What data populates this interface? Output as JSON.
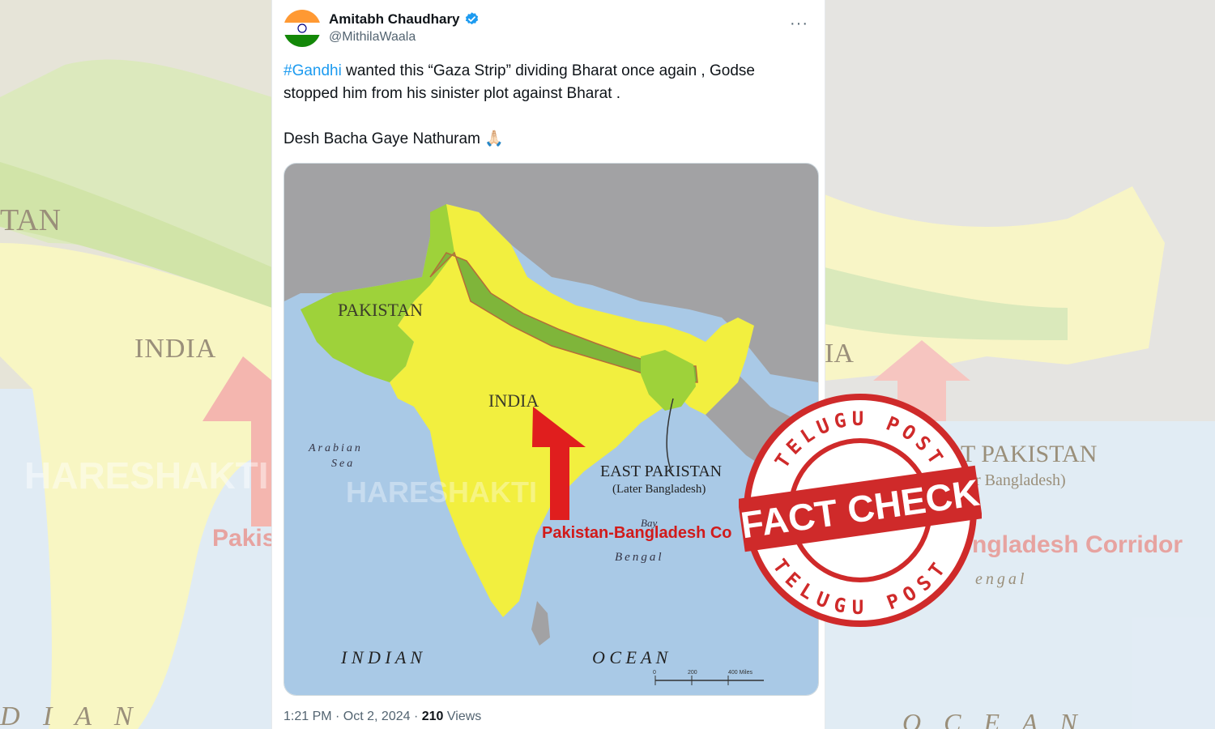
{
  "background": {
    "left_labels": {
      "india": "INDIA",
      "pakistan_partial": "TAN",
      "corridor_partial": "Pakis",
      "watermark": "HARESHAKTI",
      "ocean_partial": "D I A N"
    },
    "right_labels": {
      "east_pakistan_partial": "T PAKISTAN",
      "later_bangladesh_partial": "r Bangladesh)",
      "corridor_partial": "ngladesh Corridor",
      "india_partial": "IA",
      "bengal_partial": "engal",
      "ocean_partial": "O C E A N"
    }
  },
  "tweet": {
    "author_name": "Amitabh Chaudhary",
    "author_handle": "@MithilaWaala",
    "verified_icon": "verified-badge-icon",
    "more_icon": "more-options-icon",
    "more_label": "···",
    "hashtag": "#Gandhi",
    "text_line1_rest": " wanted this “Gaza Strip” dividing Bharat once again , Godse stopped him from his sinister plot against Bharat .",
    "text_line2": "Desh Bacha Gaye Nathuram 🙏🏻",
    "time": "1:21 PM · Oct 2, 2024 · ",
    "views_count": "210",
    "views_label": " Views"
  },
  "map": {
    "pakistan": "PAKISTAN",
    "india": "INDIA",
    "arabian_sea_1": "Arabian",
    "arabian_sea_2": "Sea",
    "east_pakistan": "EAST PAKISTAN",
    "later_bangladesh": "(Later Bangladesh)",
    "corridor": "Pakistan-Bangladesh Co",
    "bay_bengal_1": "Bay",
    "bay_bengal_2": "Bengal",
    "indian": "I N D I A N",
    "ocean": "O C E A N",
    "watermark": "HARESHAKTI",
    "scale_0": "0",
    "scale_200": "200",
    "scale_400": "400 Miles",
    "colors": {
      "sea": "#a9c9e6",
      "land_other": "#a2a2a4",
      "india": "#f2ef3f",
      "pakistan": "#9ed23a",
      "corridor": "#7fb53a",
      "arrow": "#e01e1e"
    }
  },
  "stamp": {
    "top_text": "TELUGU POST",
    "bottom_text": "TELUGU POST",
    "banner": "FACT CHECK",
    "color": "#cf2a2a"
  }
}
